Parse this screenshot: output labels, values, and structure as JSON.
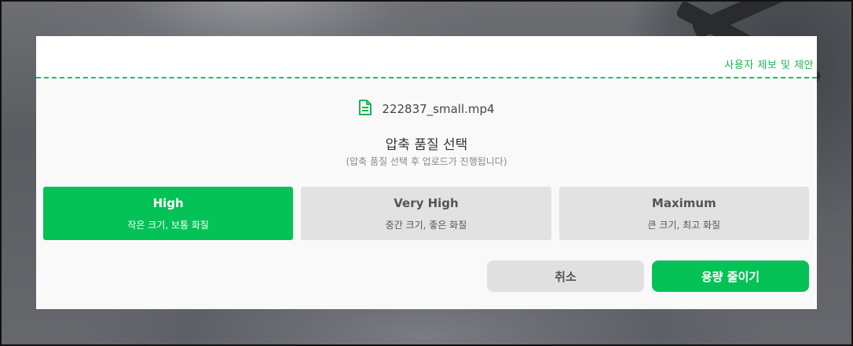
{
  "dialog": {
    "report_link": "사용자 제보 및 제안",
    "file_icon": "document-icon",
    "file_name": "222837_small.mp4",
    "title": "압축 품질 선택",
    "subtitle": "(압축 품질 선택 후 업로드가 진행됩니다)",
    "options": [
      {
        "name": "High",
        "desc": "작은 크기, 보통 화질",
        "selected": true
      },
      {
        "name": "Very High",
        "desc": "중간 크기, 좋은 화질",
        "selected": false
      },
      {
        "name": "Maximum",
        "desc": "큰 크기, 최고 화질",
        "selected": false
      }
    ],
    "cancel_label": "취소",
    "confirm_label": "용량 줄이기"
  },
  "colors": {
    "accent": "#05c256",
    "option_bg": "#e2e2e2",
    "cancel_bg": "#e0e0e0"
  }
}
